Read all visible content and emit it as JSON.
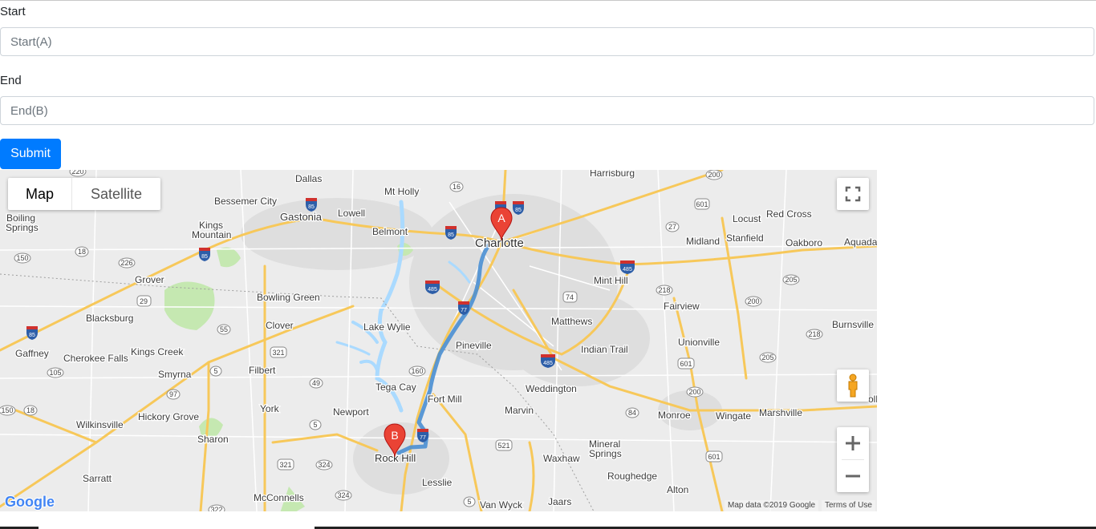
{
  "form": {
    "start_label": "Start",
    "start_placeholder": "Start(A)",
    "start_value": "",
    "end_label": "End",
    "end_placeholder": "End(B)",
    "end_value": "",
    "submit_label": "Submit"
  },
  "map": {
    "type_controls": {
      "map_label": "Map",
      "satellite_label": "Satellite",
      "selected": "Map"
    },
    "markers": {
      "start": "A",
      "end": "B"
    },
    "labels": {
      "charlotte": "Charlotte",
      "rock_hill": "Rock Hill",
      "gastonia": "Gastonia",
      "dallas": "Dallas",
      "mt_holly": "Mt Holly",
      "harrisburg": "Harrisburg",
      "bessemer_city": "Bessemer City",
      "lowell": "Lowell",
      "belmont": "Belmont",
      "kings_mountain_1": "Kings",
      "kings_mountain_2": "Mountain",
      "boiling_springs_1": "Boiling",
      "boiling_springs_2": "Springs",
      "grover": "Grover",
      "bowling_green": "Bowling Green",
      "blacksburg": "Blacksburg",
      "clover": "Clover",
      "lake_wylie": "Lake Wylie",
      "gaffney": "Gaffney",
      "cherokee_falls": "Cherokee Falls",
      "kings_creek": "Kings Creek",
      "smyrna": "Smyrna",
      "filbert": "Filbert",
      "tega_cay": "Tega Cay",
      "pineville": "Pineville",
      "fort_mill": "Fort Mill",
      "matthews": "Matthews",
      "indian_trail": "Indian Trail",
      "weddington": "Weddington",
      "marvin": "Marvin",
      "mint_hill": "Mint Hill",
      "locust": "Locust",
      "red_cross": "Red Cross",
      "midland": "Midland",
      "stanfield": "Stanfield",
      "oakboro": "Oakboro",
      "aquadale": "Aquada",
      "fairview": "Fairview",
      "unionville": "Unionville",
      "burnsville": "Burnsville",
      "monroe": "Monroe",
      "wingate": "Wingate",
      "marshville": "Marshville",
      "mineral_springs_1": "Mineral",
      "mineral_springs_2": "Springs",
      "waxhaw": "Waxhaw",
      "roughedge": "Roughedge",
      "alton": "Alton",
      "newport": "Newport",
      "york": "York",
      "hickory_grove": "Hickory Grove",
      "wilkinsville": "Wilkinsville",
      "sharon": "Sharon",
      "sarratt": "Sarratt",
      "mcconnells": "McConnells",
      "lesslie": "Lesslie",
      "van_wyck": "Van Wyck",
      "jaars": "Jaars",
      "polkton_fragment": "oll"
    },
    "route_shields": [
      "220",
      "16",
      "200",
      "601",
      "27",
      "150",
      "18",
      "226",
      "29",
      "55",
      "321",
      "105",
      "5",
      "97",
      "49",
      "160",
      "74",
      "218",
      "205",
      "200",
      "218",
      "205",
      "601",
      "200",
      "84",
      "521",
      "601",
      "150",
      "18",
      "5",
      "321",
      "324",
      "324",
      "322",
      "5",
      "85",
      "85",
      "485",
      "485",
      "77",
      "485",
      "85",
      "77",
      "77"
    ],
    "attribution": {
      "map_data": "Map data ©2019 Google",
      "terms": "Terms of Use"
    },
    "logo_text": "Google",
    "icons": [
      "fullscreen-icon",
      "pegman-icon",
      "zoom-in-icon",
      "zoom-out-icon"
    ]
  },
  "colors": {
    "primary_button": "#007bff",
    "route": "#4a8fd3",
    "marker": "#ea4335",
    "highway": "#f7c85a",
    "interstate_shield": "#2d5ea8",
    "water": "#aadaff",
    "park": "#c5e8b1",
    "urban": "#dedede"
  }
}
